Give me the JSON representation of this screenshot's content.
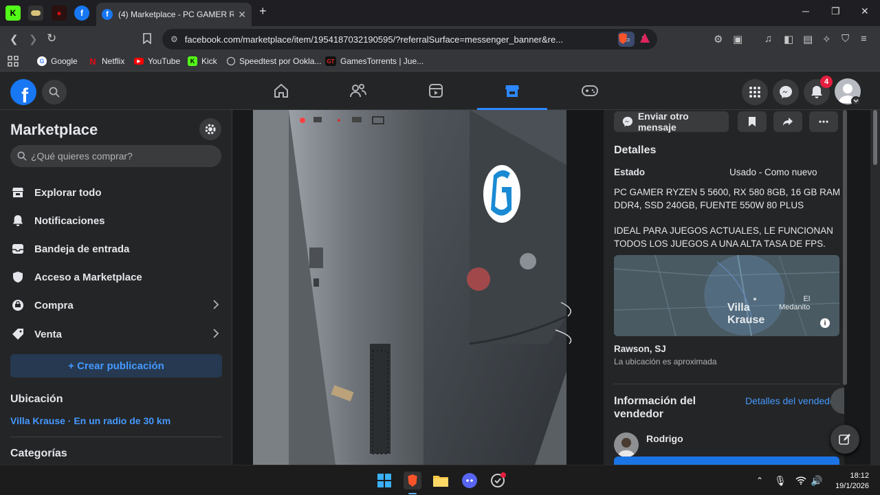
{
  "browser": {
    "active_tab_title": "(4) Marketplace - PC GAMER RYZ",
    "url": "facebook.com/marketplace/item/1954187032190595/?referralSurface=messenger_banner&re...",
    "bookmarks": [
      {
        "label": "Google",
        "icon": "google-icon"
      },
      {
        "label": "Netflix",
        "icon": "netflix-icon"
      },
      {
        "label": "YouTube",
        "icon": "youtube-icon"
      },
      {
        "label": "Kick",
        "icon": "kick-icon"
      },
      {
        "label": "Speedtest por Ookla...",
        "icon": "speedtest-icon"
      },
      {
        "label": "GamesTorrents | Jue...",
        "icon": "gamestorrents-icon"
      }
    ]
  },
  "header": {
    "notification_count": "4"
  },
  "sidebar": {
    "title": "Marketplace",
    "search_placeholder": "¿Qué quieres comprar?",
    "items": [
      {
        "label": "Explorar todo",
        "icon": "store-icon"
      },
      {
        "label": "Notificaciones",
        "icon": "bell-icon"
      },
      {
        "label": "Bandeja de entrada",
        "icon": "inbox-icon"
      },
      {
        "label": "Acceso a Marketplace",
        "icon": "shield-icon"
      },
      {
        "label": "Compra",
        "icon": "bag-icon"
      },
      {
        "label": "Venta",
        "icon": "tag-icon"
      }
    ],
    "create_button": "+ Crear publicación",
    "location_heading": "Ubicación",
    "location_value": "Villa Krause · En un radio de 30 km",
    "categories_heading": "Categorías"
  },
  "listing": {
    "message_button": "Enviar otro mensaje",
    "details_heading": "Detalles",
    "condition_label": "Estado",
    "condition_value": "Usado - Como nuevo",
    "description_1": "PC GAMER RYZEN 5 5600, RX 580 8GB, 16 GB RAM\nDDR4, SSD 240GB, FUENTE 550W 80 PLUS",
    "description_2": "IDEAL PARA JUEGOS ACTUALES, LE FUNCIONAN\nTODOS LOS JUEGOS A UNA ALTA TASA DE FPS.",
    "map_label_1": "Villa\nKrause",
    "map_label_2": "El\nMedanito",
    "location": "Rawson, SJ",
    "location_note": "La ubicación es aproximada",
    "seller_heading": "Información del\nvendedor",
    "seller_link": "Detalles del vendedor",
    "seller_name": "Rodrigo"
  },
  "taskbar": {
    "time": "18:12",
    "date": "19/1/2026"
  }
}
